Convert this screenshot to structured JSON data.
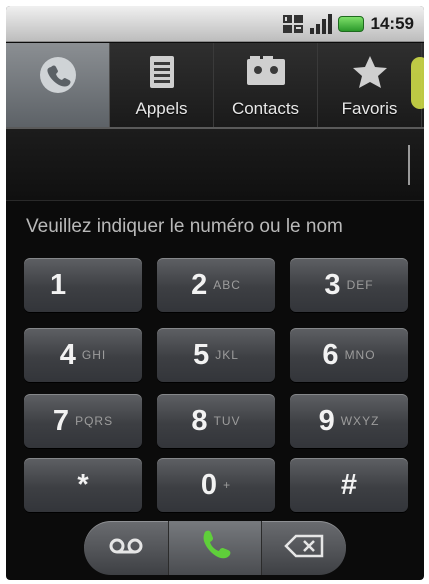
{
  "status": {
    "time": "14:59"
  },
  "tabs": [
    {
      "id": "phone",
      "label": "",
      "icon": "phone-icon",
      "active": true
    },
    {
      "id": "calls",
      "label": "Appels",
      "icon": "call-log-icon"
    },
    {
      "id": "contacts",
      "label": "Contacts",
      "icon": "contacts-icon"
    },
    {
      "id": "favorites",
      "label": "Favoris",
      "icon": "star-icon"
    }
  ],
  "dialer": {
    "hint": "Veuillez indiquer le numéro ou le nom",
    "keys": [
      {
        "digit": "1",
        "letters": ""
      },
      {
        "digit": "2",
        "letters": "ABC"
      },
      {
        "digit": "3",
        "letters": "DEF"
      },
      {
        "digit": "4",
        "letters": "GHI"
      },
      {
        "digit": "5",
        "letters": "JKL"
      },
      {
        "digit": "6",
        "letters": "MNO"
      },
      {
        "digit": "7",
        "letters": "PQRS"
      },
      {
        "digit": "8",
        "letters": "TUV"
      },
      {
        "digit": "9",
        "letters": "WXYZ"
      },
      {
        "digit": "*",
        "letters": ""
      },
      {
        "digit": "0",
        "letters": "+"
      },
      {
        "digit": "#",
        "letters": ""
      }
    ]
  },
  "actions": {
    "voicemail_icon": "voicemail-icon",
    "call_icon": "phone-icon",
    "delete_icon": "backspace-icon"
  },
  "colors": {
    "call_green": "#5fcf3a",
    "battery_green": "#3fb53a"
  }
}
